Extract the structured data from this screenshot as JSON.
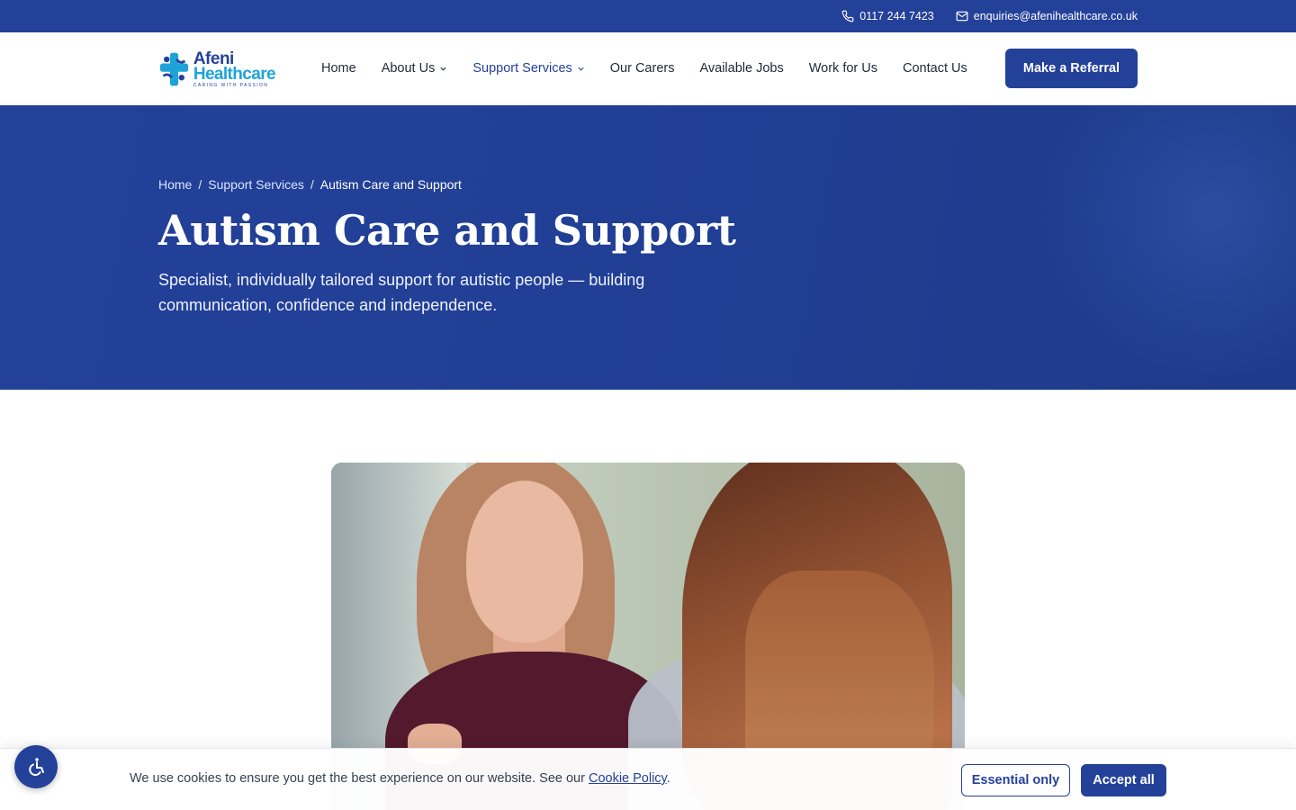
{
  "topbar": {
    "phone": "0117 244 7423",
    "email": "enquiries@afenihealthcare.co.uk"
  },
  "logo": {
    "line1": "Afeni",
    "line2": "Healthcare",
    "tagline": "CARING WITH PASSION"
  },
  "nav": {
    "items": [
      {
        "label": "Home"
      },
      {
        "label": "About Us"
      },
      {
        "label": "Support Services"
      },
      {
        "label": "Our Carers"
      },
      {
        "label": "Available Jobs"
      },
      {
        "label": "Work for Us"
      },
      {
        "label": "Contact Us"
      }
    ],
    "cta": "Make a Referral"
  },
  "breadcrumb": {
    "home": "Home",
    "sep": "/",
    "parent": "Support Services",
    "current": "Autism Care and Support"
  },
  "hero": {
    "title": "Autism Care and Support",
    "subtitle": "Specialist, individually tailored support for autistic people — building communication, confidence and independence."
  },
  "cookie": {
    "text": "We use cookies to ensure you get the best experience on our website. See our ",
    "link": "Cookie Policy",
    "trail": ".",
    "essential": "Essential only",
    "accept": "Accept all"
  },
  "colors": {
    "brand": "#24419a",
    "accent": "#1ea3d8"
  },
  "icons": {
    "phone": "phone-icon",
    "email": "mail-icon",
    "dropdown": "chevron-down-icon",
    "accessibility": "accessibility-icon"
  }
}
